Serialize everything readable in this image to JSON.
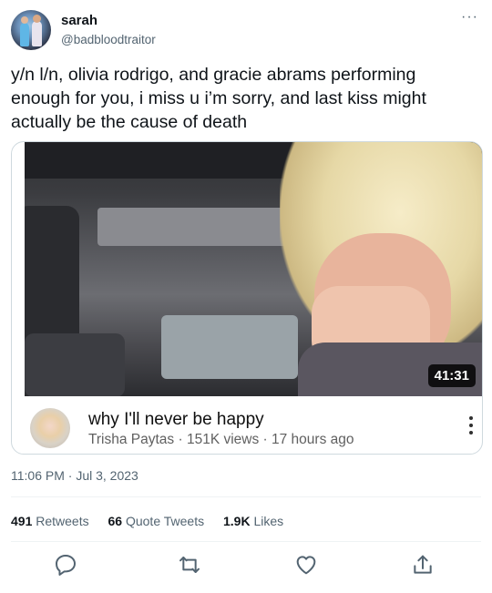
{
  "author": {
    "name": "sarah",
    "handle": "@badbloodtraitor"
  },
  "tweet": {
    "text": "y/n l/n, olivia rodrigo, and gracie abrams performing enough for you, i miss u i’m sorry, and last kiss might actually be the cause of death",
    "timestamp": "11:06 PM · Jul 3, 2023"
  },
  "more_menu": "···",
  "video_card": {
    "duration": "41:31",
    "title": "why I'll never be happy",
    "meta": "Trisha Paytas · 151K views · 17 hours ago"
  },
  "stats": {
    "retweets_count": "491",
    "retweets_label": " Retweets",
    "quotes_count": "66",
    "quotes_label": " Quote Tweets",
    "likes_count": "1.9K",
    "likes_label": " Likes"
  },
  "actions": [
    "reply-icon",
    "retweet-icon",
    "like-icon",
    "share-icon"
  ],
  "colors": {
    "text": "#0f1419",
    "secondary": "#536471",
    "border": "#cfd9de"
  }
}
